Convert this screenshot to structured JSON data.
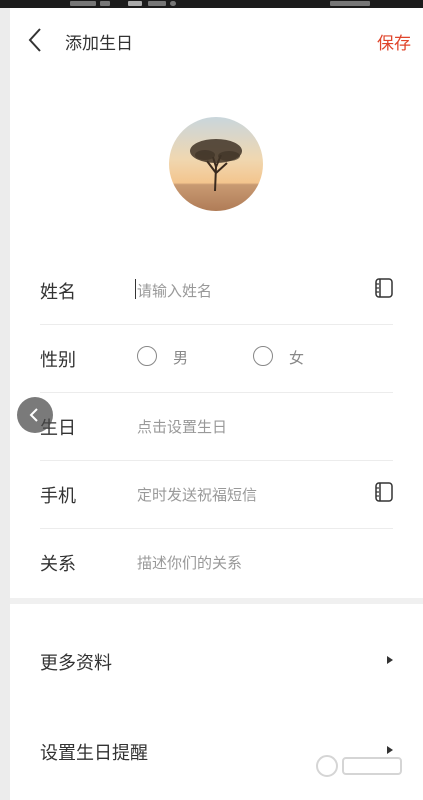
{
  "header": {
    "title": "添加生日",
    "save_label": "保存",
    "back_icon": "chevron-left-icon"
  },
  "avatar": {
    "description_icon": "tree-photo-avatar"
  },
  "form": {
    "name": {
      "label": "姓名",
      "placeholder": "请输入姓名",
      "icon": "contact-book-icon"
    },
    "gender": {
      "label": "性别",
      "options": [
        "男",
        "女"
      ]
    },
    "birthday": {
      "label": "生日",
      "placeholder": "点击设置生日"
    },
    "phone": {
      "label": "手机",
      "placeholder": "定时发送祝福短信",
      "icon": "contact-book-icon"
    },
    "relation": {
      "label": "关系",
      "placeholder": "描述你们的关系"
    }
  },
  "sections": {
    "more_info": "更多资料",
    "birthday_reminder": "设置生日提醒"
  },
  "colors": {
    "accent": "#e0452b",
    "text": "#333333",
    "placeholder": "#999999"
  }
}
